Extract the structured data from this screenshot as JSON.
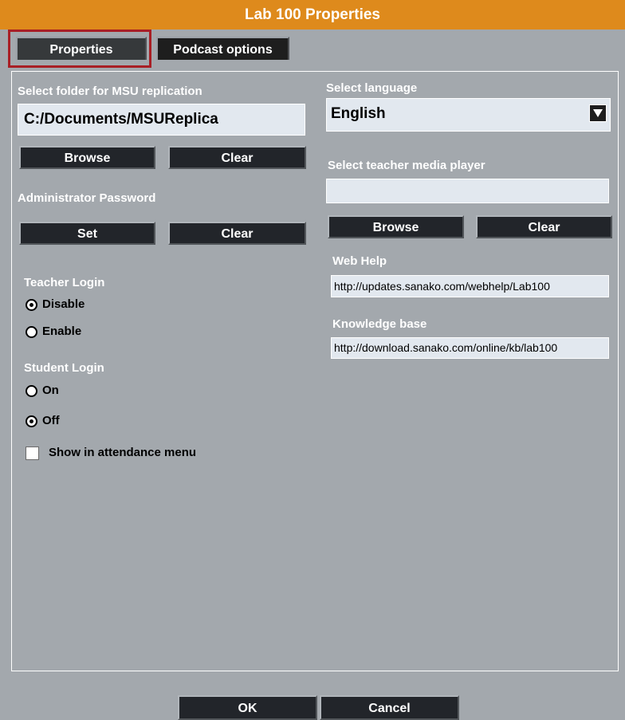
{
  "window": {
    "title": "Lab 100 Properties"
  },
  "tabs": {
    "properties": "Properties",
    "podcast_options": "Podcast options"
  },
  "left": {
    "msu_label": "Select folder for MSU replication",
    "msu_path": "C:/Documents/MSUReplica",
    "msu_browse": "Browse",
    "msu_clear": "Clear",
    "admin_label": "Administrator Password",
    "admin_set": "Set",
    "admin_clear": "Clear",
    "teacher_login_label": "Teacher Login",
    "teacher_disable": "Disable",
    "teacher_enable": "Enable",
    "teacher_selected": "Disable",
    "student_login_label": "Student Login",
    "student_on": "On",
    "student_off": "Off",
    "student_selected": "Off",
    "attendance_label": "Show in attendance menu",
    "attendance_checked": false
  },
  "right": {
    "language_label": "Select language",
    "language_value": "English",
    "media_player_label": "Select teacher media player",
    "media_player_value": "",
    "media_browse": "Browse",
    "media_clear": "Clear",
    "webhelp_label": "Web Help",
    "webhelp_url": "http://updates.sanako.com/webhelp/Lab100",
    "kb_label": "Knowledge base",
    "kb_url": "http://download.sanako.com/online/kb/lab100"
  },
  "footer": {
    "ok": "OK",
    "cancel": "Cancel"
  },
  "colors": {
    "title_bar": "#de8a1c",
    "background": "#a3a8ad",
    "button": "#22252a",
    "tab_highlight": "#a81f25"
  }
}
